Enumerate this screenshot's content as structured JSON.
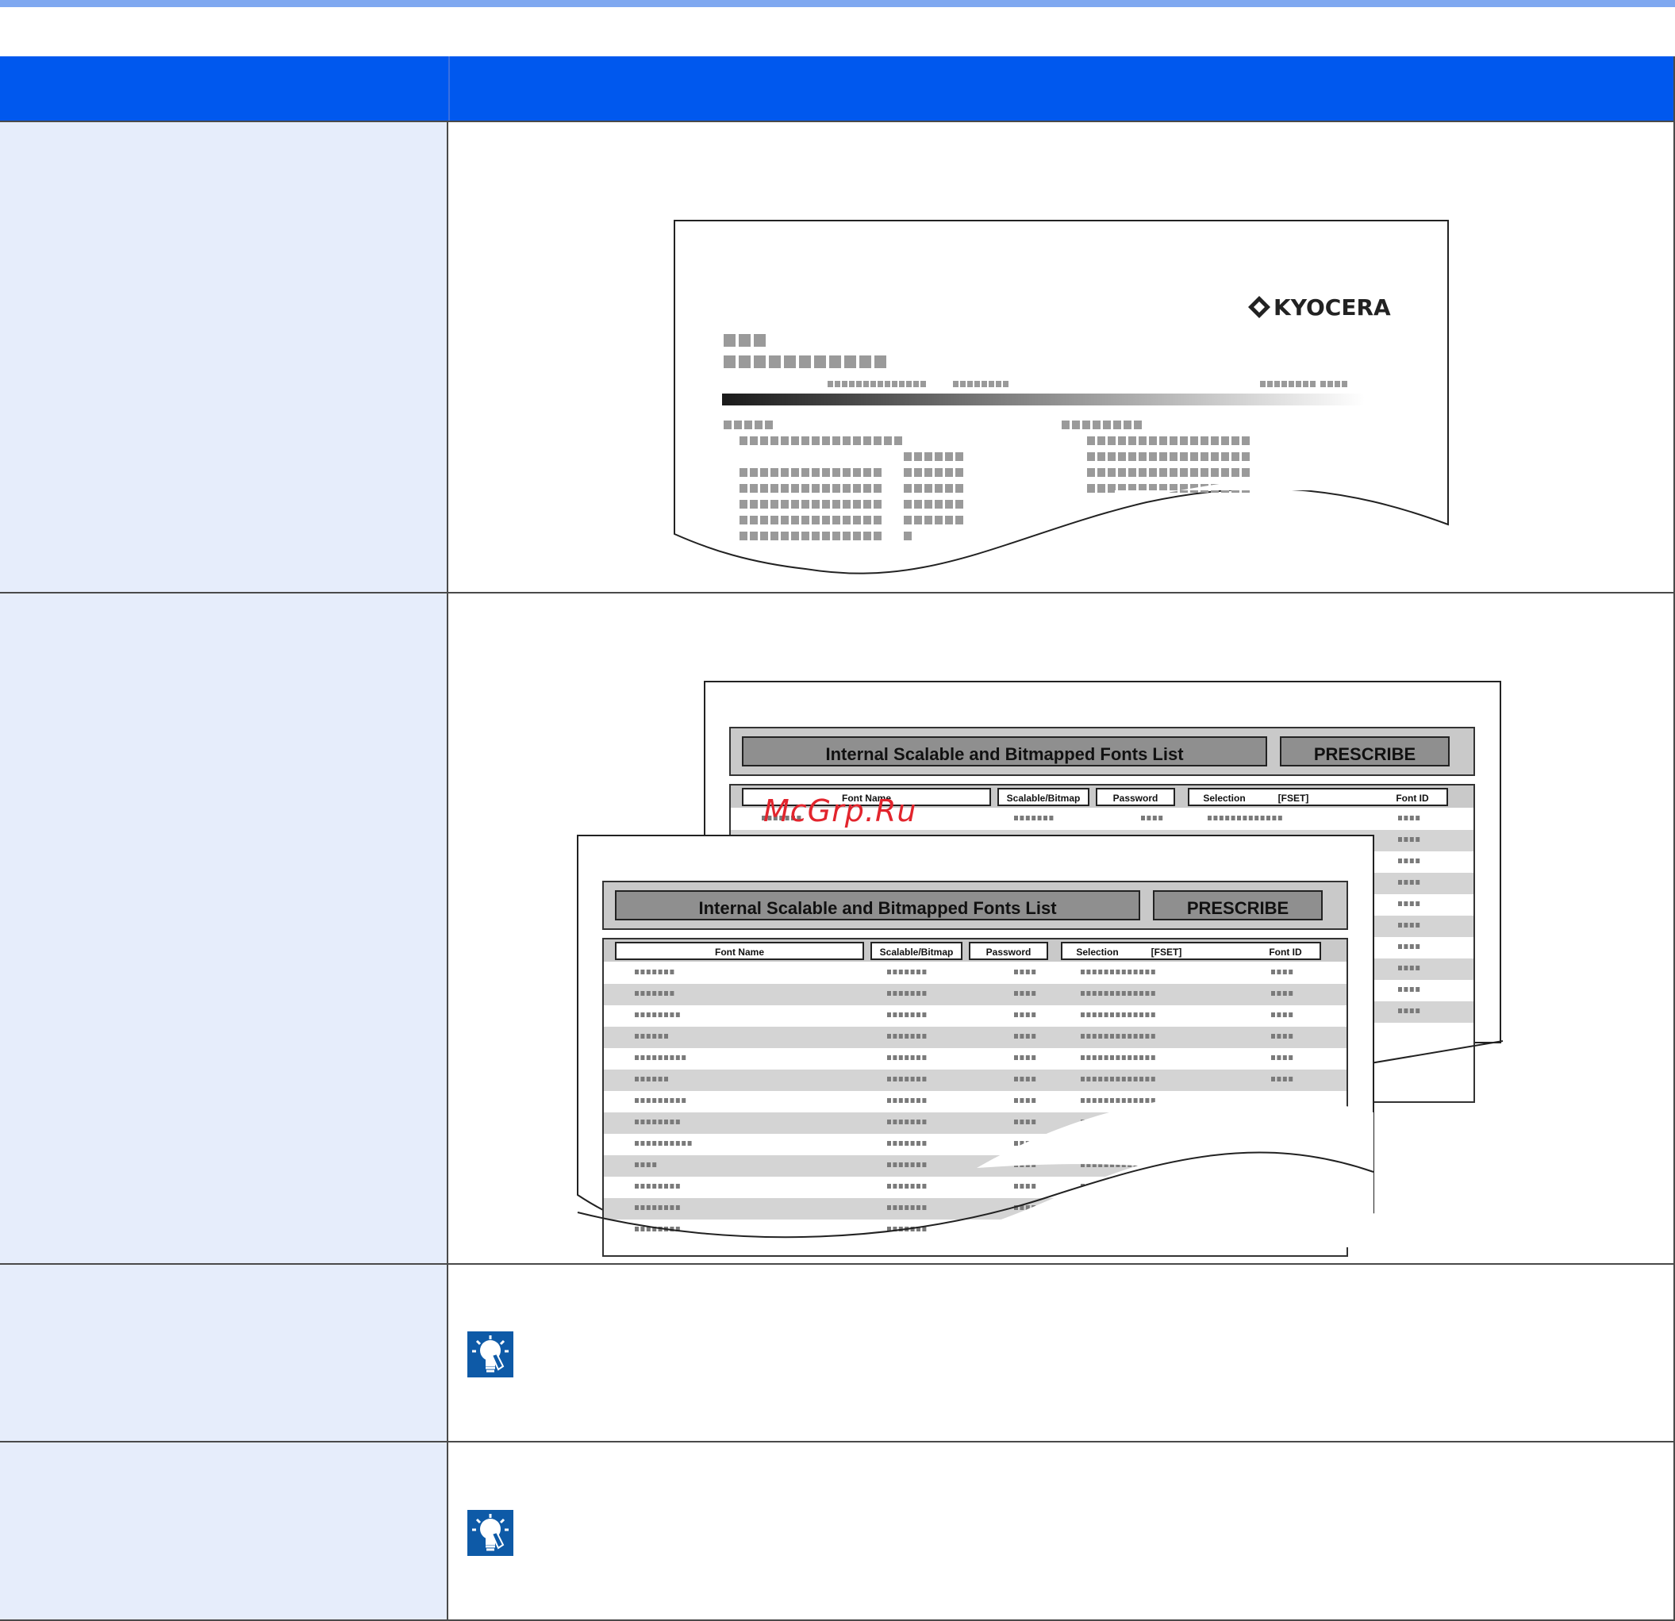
{
  "table": {
    "header": {
      "col1": "",
      "col2": ""
    },
    "rows": [
      {
        "label": "",
        "description": ""
      },
      {
        "label": "",
        "description": ""
      },
      {
        "label": "",
        "description": "",
        "hint_icon": "lightbulb-icon"
      },
      {
        "label": "",
        "description": "",
        "hint_icon": "lightbulb-icon"
      }
    ]
  },
  "status_page_illustration": {
    "logo_text": "KYOCERA"
  },
  "font_list_illustration": {
    "title": "Internal Scalable and Bitmapped Fonts List",
    "badge": "PRESCRIBE",
    "columns": {
      "font_name": "Font Name",
      "scalable": "Scalable/Bitmap",
      "password": "Password",
      "selection": "Selection",
      "fset": "[FSET]",
      "font_id": "Font ID"
    }
  },
  "watermark": "McGrp.Ru",
  "colors": {
    "header_blue": "#0058ee",
    "label_cell": "#e6edfb",
    "top_rule": "#7fa8f0",
    "hint_icon_bg": "#0e5aa7"
  }
}
